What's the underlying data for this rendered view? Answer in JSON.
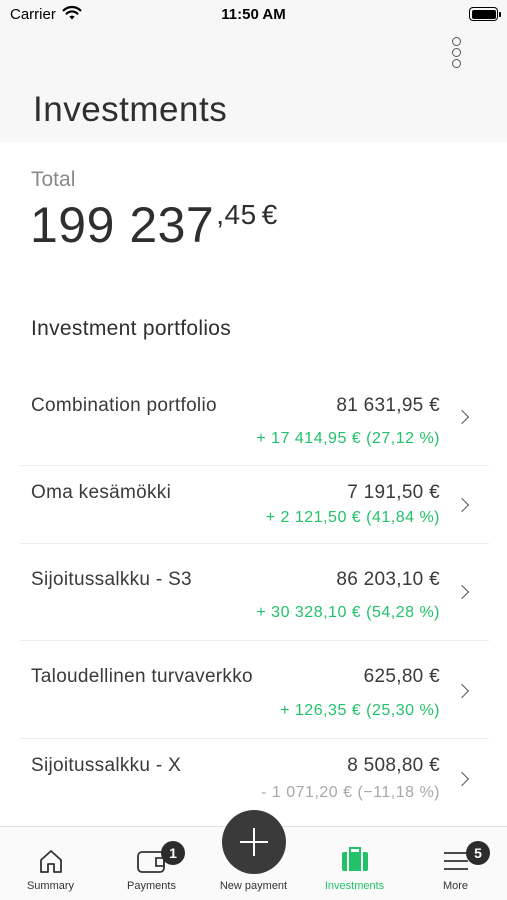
{
  "status_bar": {
    "carrier": "Carrier",
    "time": "11:50 AM"
  },
  "header": {
    "title": "Investments"
  },
  "total": {
    "label": "Total",
    "whole": "199 237",
    "cents": ",45",
    "currency": "€"
  },
  "portfolios_section": {
    "title": "Investment portfolios"
  },
  "portfolios": [
    {
      "name": "Combination portfolio",
      "value": "81 631,95 €",
      "change": "+ 17 414,95 € (27,12 %)",
      "trend": "positive"
    },
    {
      "name": "Oma kesämökki",
      "value": "7 191,50 €",
      "change": "+ 2 121,50 € (41,84 %)",
      "trend": "positive"
    },
    {
      "name": "Sijoitussalkku - S3",
      "value": "86 203,10 €",
      "change": "+ 30 328,10 € (54,28 %)",
      "trend": "positive"
    },
    {
      "name": "Taloudellinen turvaverkko",
      "value": "625,80 €",
      "change": "+ 126,35 € (25,30 %)",
      "trend": "positive"
    },
    {
      "name": "Sijoitussalkku - X",
      "value": "8 508,80 €",
      "change": "- 1 071,20 € (−11,18 %)",
      "trend": "negative"
    }
  ],
  "tab_bar": {
    "tabs": [
      {
        "label": "Summary",
        "icon": "home-icon"
      },
      {
        "label": "Payments",
        "icon": "wallet-icon",
        "badge": "1"
      },
      {
        "label": "New payment",
        "icon": "plus-icon"
      },
      {
        "label": "Investments",
        "icon": "briefcase-icon",
        "active": true
      },
      {
        "label": "More",
        "icon": "menu-icon",
        "badge": "5"
      }
    ]
  },
  "colors": {
    "positive": "#22c26a",
    "negative": "#a8a8a8",
    "active_tab": "#22c26a",
    "fab": "#3a3a3a"
  }
}
